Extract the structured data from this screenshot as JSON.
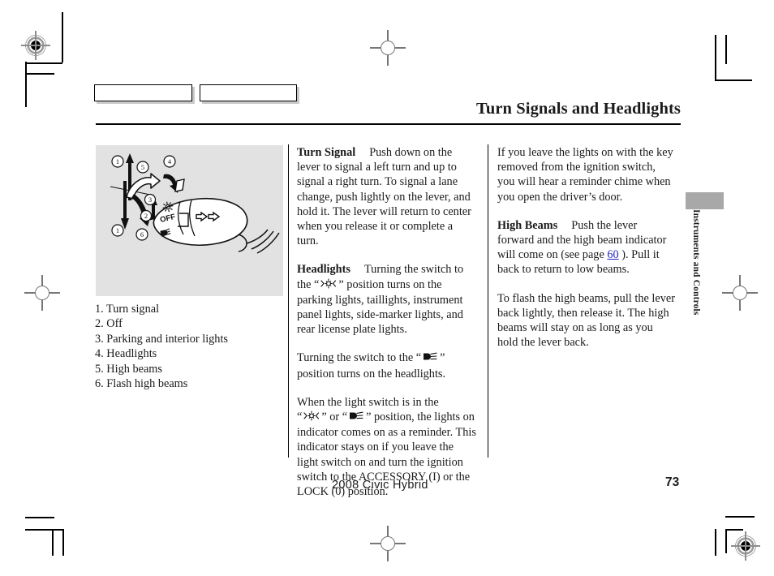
{
  "document": {
    "title": "Turn Signals and Headlights",
    "footer_model": "2008  Civic  Hybrid",
    "page_number": "73",
    "side_tab_label": "Instruments and Controls"
  },
  "illustration": {
    "alt": "Turn signal and headlight lever diagram",
    "background_color": "#e2e2e2",
    "off_label": "OFF",
    "callout_numbers": [
      "1",
      "2",
      "3",
      "4",
      "5",
      "6",
      "1"
    ]
  },
  "caption_list": [
    "1. Turn signal",
    "2. Off",
    "3. Parking and interior lights",
    "4. Headlights",
    "5. High beams",
    "6. Flash high beams"
  ],
  "middle_column": {
    "turn_signal_heading": "Turn Signal",
    "turn_signal_text": "Push down on the lever to signal a left turn and up to signal a right turn. To signal a lane change, push lightly on the lever, and hold it. The lever will return to center when you release it or complete a turn.",
    "headlights_heading": "Headlights",
    "headlights_text_a": "Turning the switch to the “",
    "headlights_text_b": "” position turns on the parking lights, taillights, instrument panel lights, side-marker lights, and rear license plate lights.",
    "headlamp_para_a": "Turning the switch to the “",
    "headlamp_para_b": "” position turns on the headlights.",
    "indicator_para_a": "When the light switch is in the",
    "indicator_para_b": "“",
    "indicator_para_c": "” or “",
    "indicator_para_d": "” position, the lights on indicator comes on as a reminder. This indicator stays on if you leave the light switch on and turn the ignition switch to the ACCESSORY (I) or the LOCK (0) position."
  },
  "right_column": {
    "reminder_text": "If you leave the lights on with the key removed from the ignition switch, you will hear a reminder chime when you open the driver’s door.",
    "high_beams_heading": "High Beams",
    "high_beams_text_a": "Push the lever forward and the high beam indicator will come on (see page ",
    "high_beams_link": "60",
    "high_beams_text_b": " ). Pull it back to return to low beams.",
    "flash_text": "To flash the high beams, pull the lever back lightly, then release it. The high beams will stay on as long as you hold the lever back."
  },
  "colors": {
    "link": "#2222cc",
    "tab_gray": "#a8a8a8",
    "illustration_gray": "#e2e2e2",
    "rule": "#000000"
  }
}
